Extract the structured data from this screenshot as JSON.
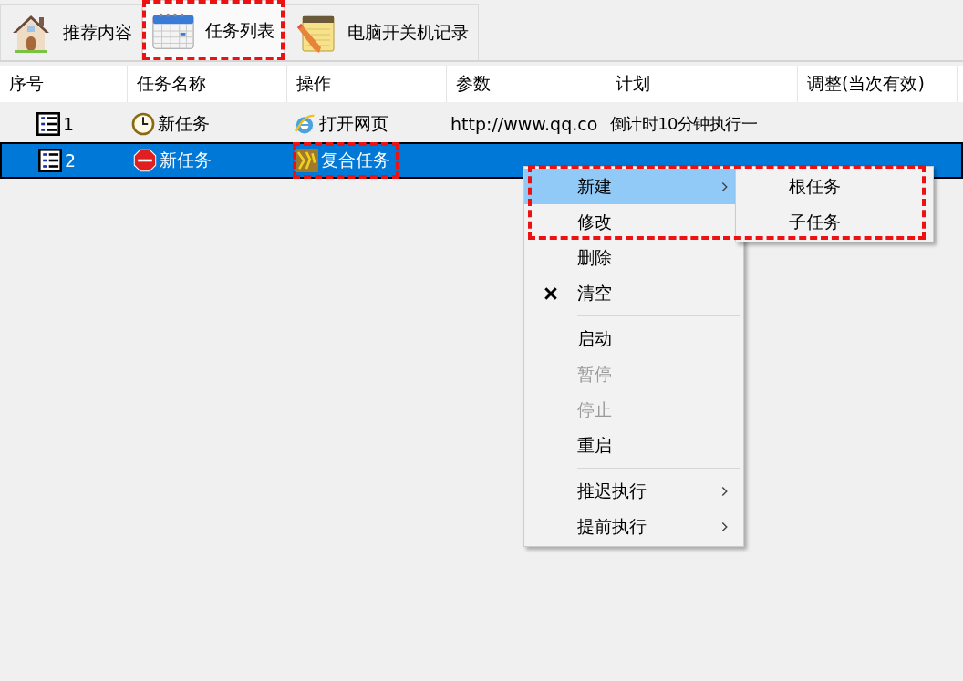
{
  "tabs": [
    {
      "label": "推荐内容",
      "selected": false,
      "highlighted": false
    },
    {
      "label": "任务列表",
      "selected": true,
      "highlighted": true
    },
    {
      "label": "电脑开关机记录",
      "selected": false,
      "highlighted": false
    }
  ],
  "table": {
    "columns": [
      "序号",
      "任务名称",
      "操作",
      "参数",
      "计划",
      "调整(当次有效)"
    ],
    "rows": [
      {
        "index": "1",
        "name": "新任务",
        "action": "打开网页",
        "action_highlighted": false,
        "params": "http://www.qq.co",
        "plan": "倒计时10分钟执行一",
        "selected": false
      },
      {
        "index": "2",
        "name": "新任务",
        "action": "复合任务",
        "action_highlighted": true,
        "selected": true
      }
    ]
  },
  "context_menu": {
    "highlighted": true,
    "items": [
      {
        "kind": "submenu",
        "label": "新建",
        "selected": true,
        "disabled": false,
        "checked": false
      },
      {
        "kind": "item",
        "label": "修改",
        "selected": false,
        "disabled": false,
        "checked": false
      },
      {
        "kind": "item",
        "label": "删除",
        "selected": false,
        "disabled": false,
        "checked": false
      },
      {
        "kind": "item",
        "label": "清空",
        "selected": false,
        "disabled": false,
        "checked": true
      },
      {
        "kind": "separator"
      },
      {
        "kind": "item",
        "label": "启动",
        "selected": false,
        "disabled": false,
        "checked": false
      },
      {
        "kind": "item",
        "label": "暂停",
        "selected": false,
        "disabled": true,
        "checked": false
      },
      {
        "kind": "item",
        "label": "停止",
        "selected": false,
        "disabled": true,
        "checked": false
      },
      {
        "kind": "item",
        "label": "重启",
        "selected": false,
        "disabled": false,
        "checked": false
      },
      {
        "kind": "separator"
      },
      {
        "kind": "submenu",
        "label": "推迟执行",
        "selected": false,
        "disabled": false,
        "checked": false
      },
      {
        "kind": "submenu",
        "label": "提前执行",
        "selected": false,
        "disabled": false,
        "checked": false
      }
    ],
    "submenu": {
      "items": [
        "根任务",
        "子任务"
      ]
    }
  }
}
